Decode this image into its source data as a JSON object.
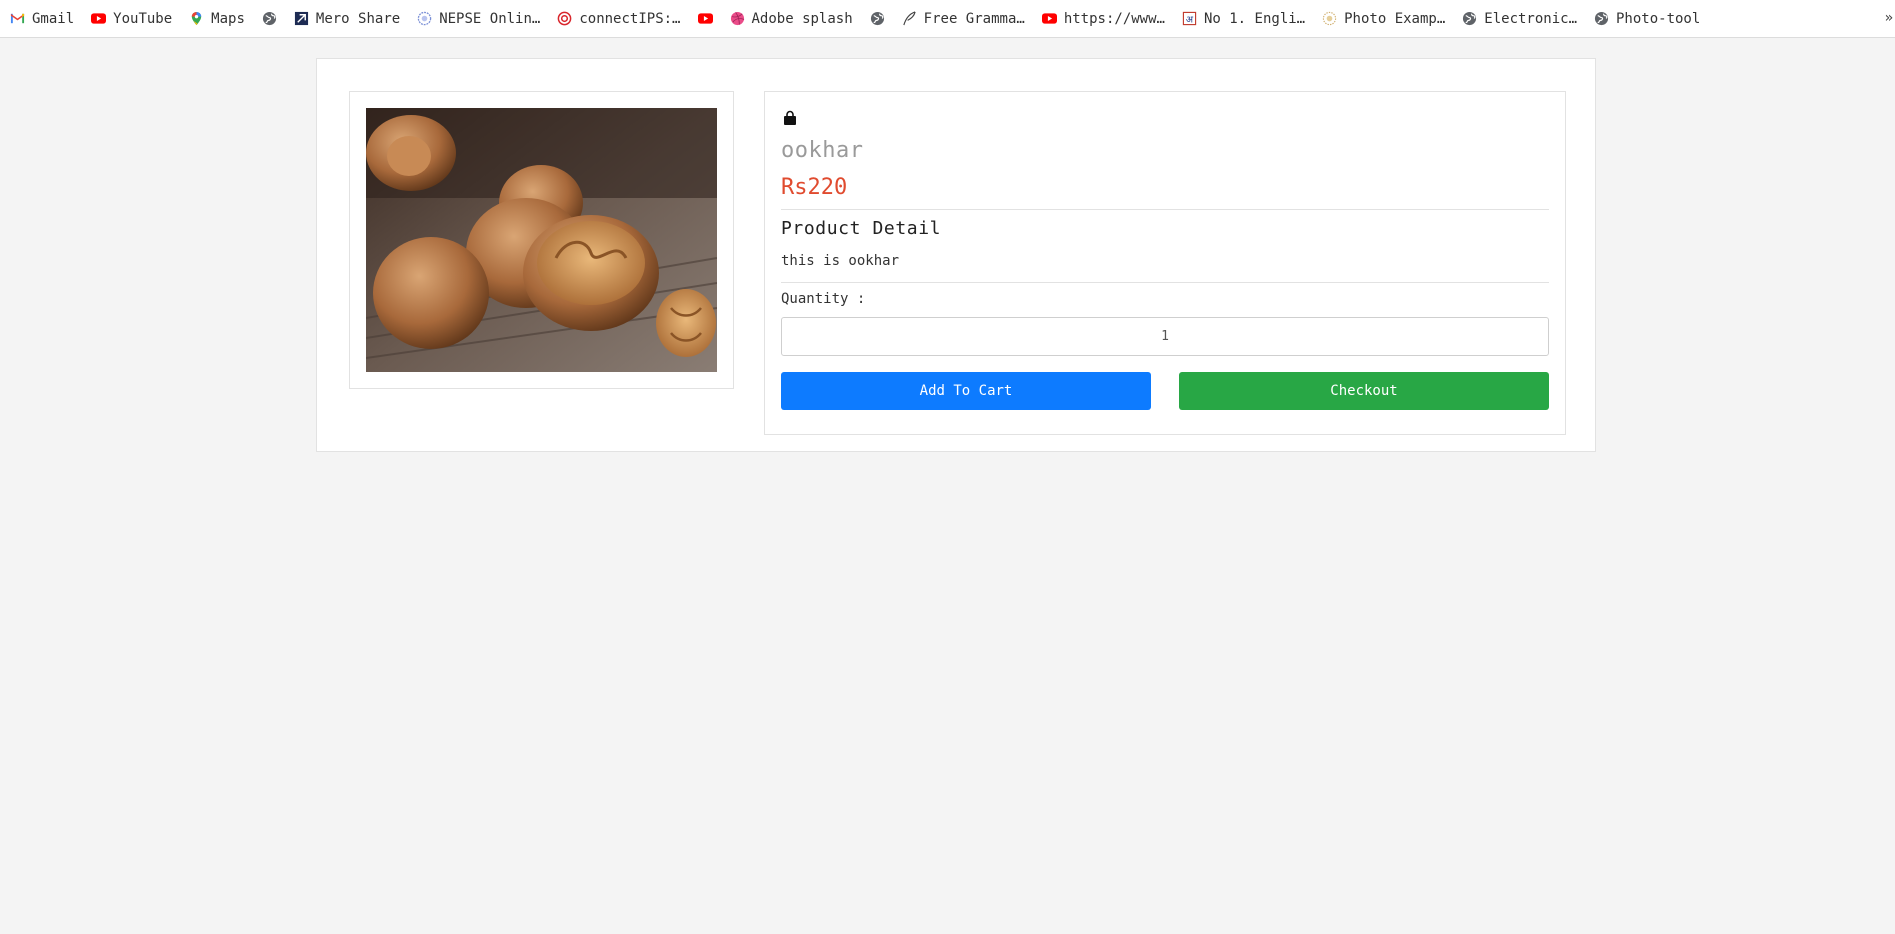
{
  "bookmarks": [
    {
      "label": "Gmail",
      "icon": "gmail-icon"
    },
    {
      "label": "YouTube",
      "icon": "youtube-icon"
    },
    {
      "label": "Maps",
      "icon": "maps-pin-icon"
    },
    {
      "label": "",
      "icon": "globe-icon"
    },
    {
      "label": "Mero Share",
      "icon": "mero-share-icon"
    },
    {
      "label": "NEPSE Onlin…",
      "icon": "nepse-icon"
    },
    {
      "label": "connectIPS:…",
      "icon": "connectips-icon"
    },
    {
      "label": "",
      "icon": "youtube-icon"
    },
    {
      "label": "Adobe splash",
      "icon": "dribbble-icon"
    },
    {
      "label": "",
      "icon": "globe-icon"
    },
    {
      "label": "Free Gramma…",
      "icon": "quill-icon"
    },
    {
      "label": "https://www…",
      "icon": "youtube-icon"
    },
    {
      "label": "No 1. Engli…",
      "icon": "dictionary-icon"
    },
    {
      "label": "Photo Examp…",
      "icon": "sun-icon"
    },
    {
      "label": "Electronic…",
      "icon": "globe-icon"
    },
    {
      "label": "Photo-tool",
      "icon": "globe-icon"
    }
  ],
  "bookmarks_overflow": "»",
  "product": {
    "name": "ookhar",
    "price": "Rs220",
    "detail_heading": "Product Detail",
    "description": "this is ookhar",
    "quantity_label": "Quantity :",
    "quantity_value": "1",
    "add_to_cart_label": "Add To Cart",
    "checkout_label": "Checkout",
    "image": "walnuts-photo",
    "icon": "shopping-bag-icon"
  },
  "colors": {
    "price": "#e04b2f",
    "add_to_cart": "#0d7bff",
    "checkout": "#28a745",
    "name": "#9a9a9a"
  }
}
